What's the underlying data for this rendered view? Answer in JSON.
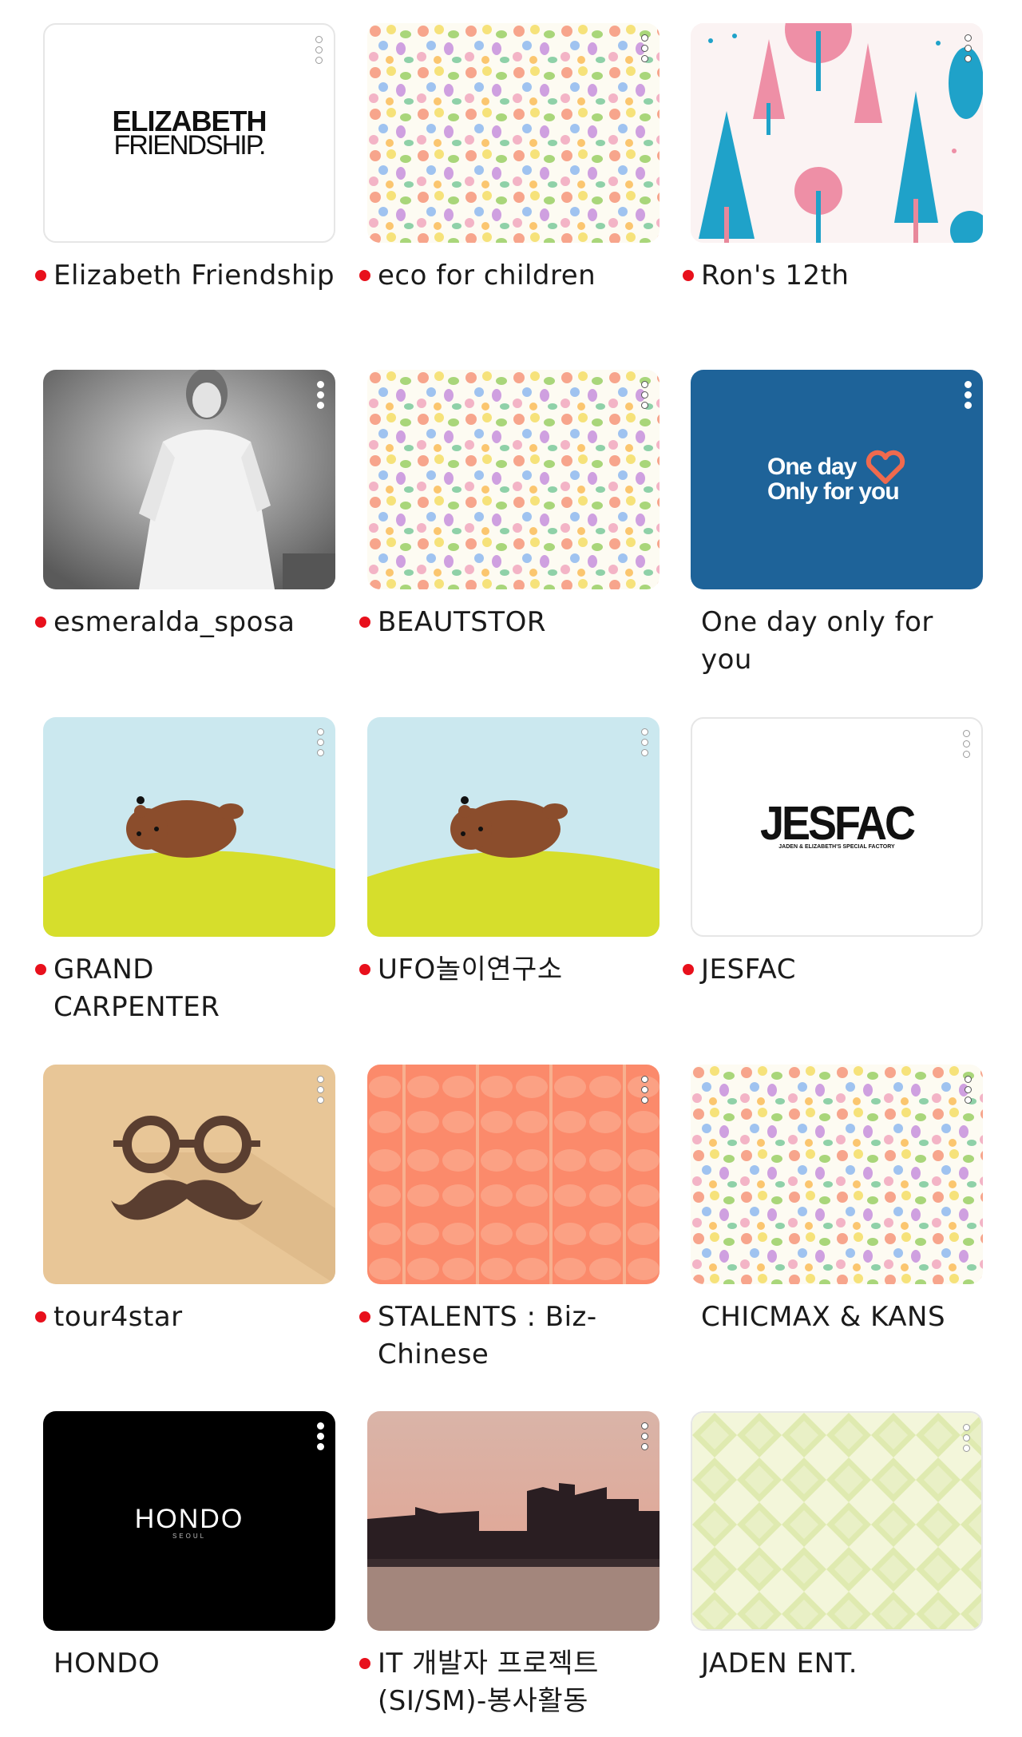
{
  "items": [
    {
      "name": "Elizabeth Friendship",
      "unread": true,
      "logo": [
        "ELIZABETH",
        "FRIENDSHIP."
      ]
    },
    {
      "name": "eco for children",
      "unread": true,
      "pattern": "floral"
    },
    {
      "name": "Ron's 12th",
      "unread": true,
      "pattern": "trees"
    },
    {
      "name": "esmeralda_sposa",
      "unread": true,
      "pattern": "bride-photo"
    },
    {
      "name": "BEAUTSTOR",
      "unread": true,
      "pattern": "floral"
    },
    {
      "name": "One day only for you",
      "unread": false,
      "logo": [
        "One day",
        "Only for you"
      ]
    },
    {
      "name": "GRAND CARPENTER",
      "unread": true,
      "pattern": "bear"
    },
    {
      "name": "UFO놀이연구소",
      "unread": true,
      "pattern": "bear"
    },
    {
      "name": "JESFAC",
      "unread": true,
      "logo": [
        "JESFAC",
        "JADEN & ELIZABETH'S SPECIAL FACTORY"
      ]
    },
    {
      "name": "tour4star",
      "unread": true,
      "pattern": "mustache"
    },
    {
      "name": "STALENTS : Biz-Chinese",
      "unread": true,
      "pattern": "leaves"
    },
    {
      "name": "CHICMAX & KANS",
      "unread": false,
      "pattern": "floral"
    },
    {
      "name": "HONDO",
      "unread": false,
      "logo": [
        "HONDO",
        "SEOUL"
      ]
    },
    {
      "name": "IT 개발자 프로젝트(SI/SM)-봉사활동",
      "unread": true,
      "pattern": "sunset-photo"
    },
    {
      "name": "JADEN ENT.",
      "unread": false,
      "pattern": "diamonds"
    }
  ],
  "colors": {
    "unread_dot": "#e8101c",
    "caption_text": "#1a1a1a",
    "oneday_bg": "#1e6399",
    "oneday_heart": "#ef6a4e"
  }
}
